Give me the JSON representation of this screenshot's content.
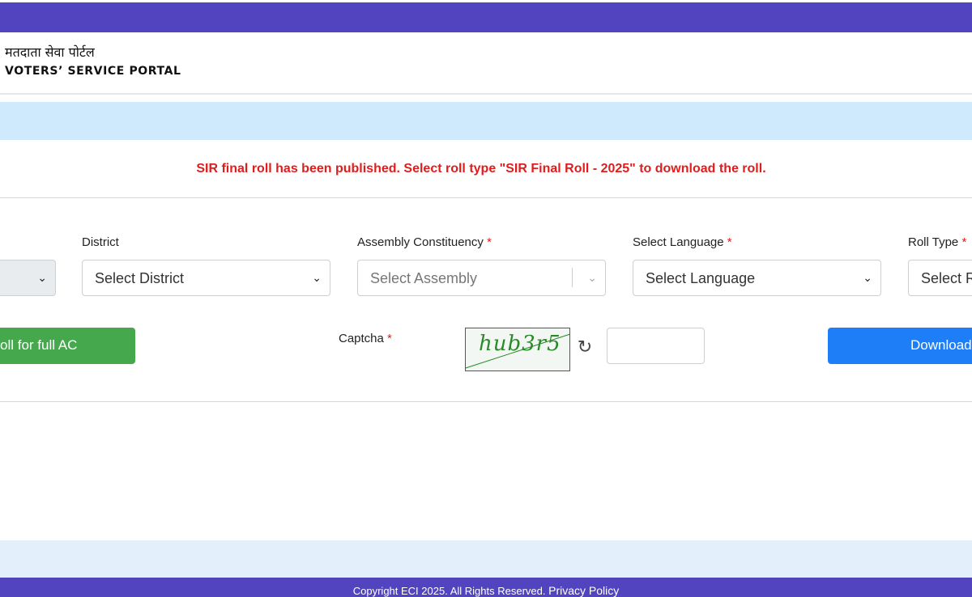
{
  "header": {
    "title_hindi": "मतदाता सेवा पोर्टल",
    "title_english": "VOTERS’ SERVICE PORTAL"
  },
  "notice": "SIR final roll has been published. Select roll type \"SIR Final Roll - 2025\" to download the roll.",
  "form": {
    "district": {
      "label": "District",
      "value": "Select District"
    },
    "assembly": {
      "label": "Assembly Constituency",
      "required": "*",
      "value": "Select Assembly"
    },
    "language": {
      "label": "Select Language",
      "required": "*",
      "value": "Select Language"
    },
    "roll_type": {
      "label": "Roll Type",
      "required": "*",
      "value": "Select R"
    },
    "full_ac_button": "oll for full AC",
    "captcha": {
      "label": "Captcha",
      "required": "*",
      "image_text": "hub3r5"
    },
    "download_button": "Download"
  },
  "footer": {
    "copyright": "Copyright ECI 2025. All Rights Reserved.",
    "privacy_link": "Privacy Policy"
  },
  "colors": {
    "brand_purple": "#5244be",
    "notice_red": "#e01d1d",
    "green_button": "#45a84d",
    "blue_button": "#1e7ef8"
  },
  "icons": {
    "chevron": "chevron-down-icon",
    "refresh": "refresh-icon"
  }
}
